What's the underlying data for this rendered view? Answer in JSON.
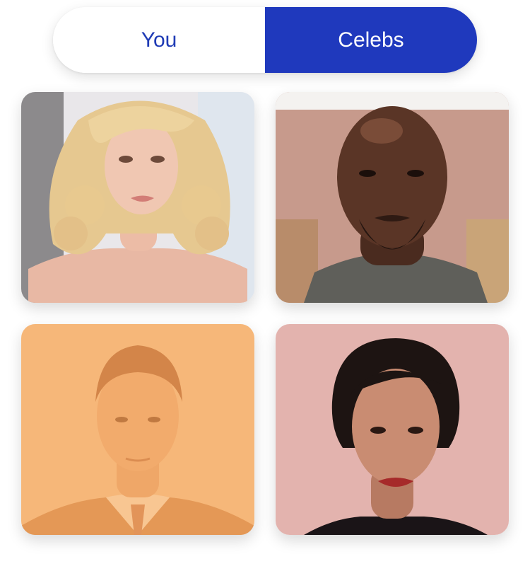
{
  "toggle": {
    "you_label": "You",
    "celebs_label": "Celebs",
    "active": "celebs",
    "active_color": "#1f39bd"
  },
  "celebs": [
    {
      "icon": "portrait-blonde-woman",
      "selected": false
    },
    {
      "icon": "portrait-bald-man",
      "selected": false
    },
    {
      "icon": "portrait-man-suit",
      "selected": true
    },
    {
      "icon": "portrait-dark-hair-woman",
      "selected": false
    }
  ],
  "colors": {
    "selection_tint": "#f6a75a"
  }
}
